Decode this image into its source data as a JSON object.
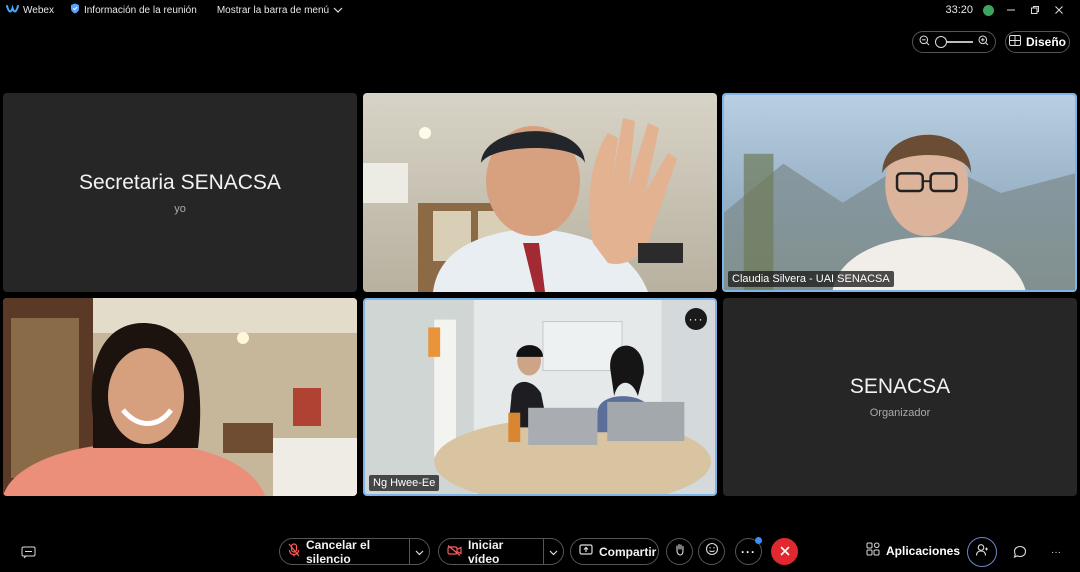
{
  "topbar": {
    "app_name": "Webex",
    "meeting_info": "Información de la reunión",
    "show_menu": "Mostrar la barra de menú",
    "time": "33:20"
  },
  "controls": {
    "layout_label": "Diseño"
  },
  "tiles": {
    "me": {
      "name": "Secretaria SENACSA",
      "sub": "yo"
    },
    "claudia": {
      "name": "Claudia Silvera - UAI SENACSA"
    },
    "ng": {
      "name": "Ng Hwee-Ee",
      "more": "···"
    },
    "host": {
      "name": "SENACSA",
      "sub": "Organizador"
    }
  },
  "bottombar": {
    "unmute_label": "Cancelar el silencio",
    "video_label": "Iniciar vídeo",
    "share_label": "Compartir",
    "more": "···",
    "apps_label": "Aplicaciones",
    "overflow": "···"
  },
  "colors": {
    "end_call": "#e0282e",
    "active_border": "#7fb4e6",
    "tile_bg": "#262626"
  }
}
